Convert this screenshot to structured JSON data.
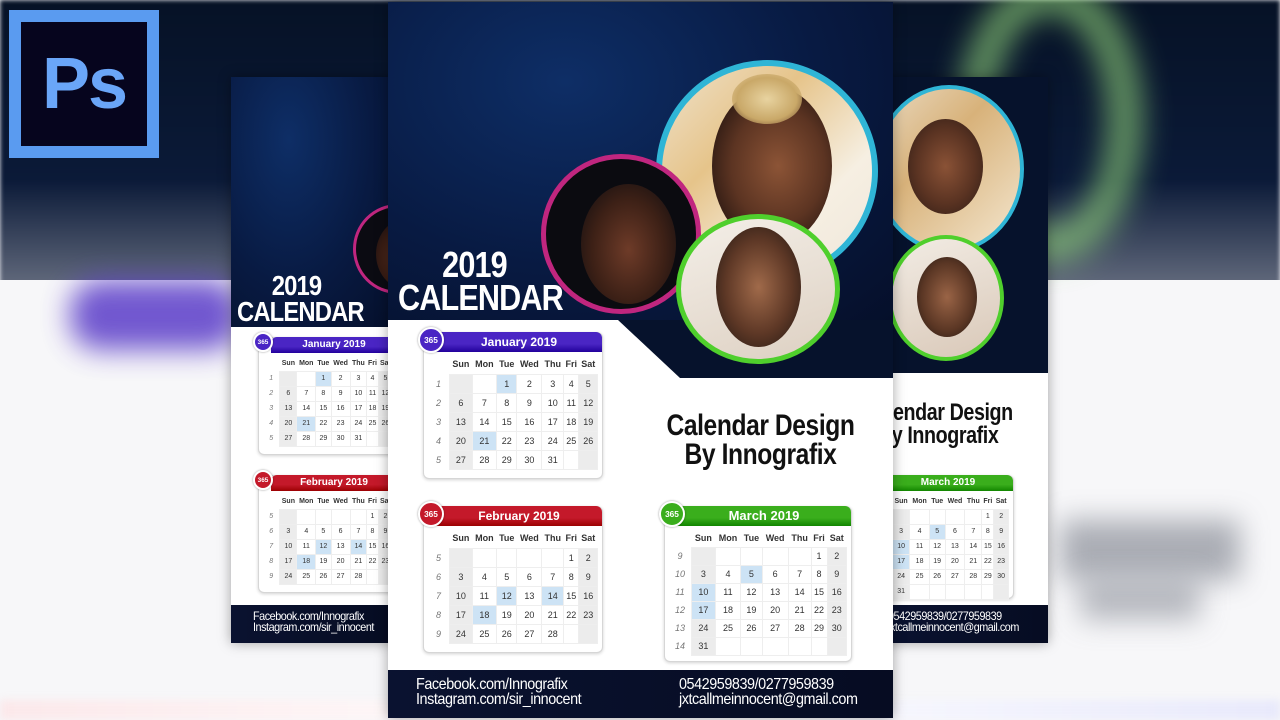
{
  "app": {
    "logo_text": "Ps",
    "logo_name": "Adobe Photoshop"
  },
  "poster": {
    "title_line1": "2019",
    "title_line2": "CALENDAR",
    "design_title_line1": "Calendar Design",
    "design_title_line2": "By Innografix",
    "footer": {
      "facebook": "Facebook.com/Innografix",
      "instagram": "Instagram.com/sir_innocent",
      "phone": "0542959839/0277959839",
      "email": "jxtcallmeinnocent@gmail.com"
    },
    "photo_ring_colors": {
      "top_right": "#2fb5d6",
      "left": "#c0267f",
      "bottom": "#4fcf2c"
    },
    "weekdays": [
      "Sun",
      "Mon",
      "Tue",
      "Wed",
      "Thu",
      "Fri",
      "Sat"
    ],
    "badge_text": "365",
    "calendars": [
      {
        "title": "January 2019",
        "color": "#4a25c4",
        "weeks": [
          {
            "num": "1",
            "days": [
              "",
              "",
              "1",
              "2",
              "3",
              "4",
              "5"
            ]
          },
          {
            "num": "2",
            "days": [
              "6",
              "7",
              "8",
              "9",
              "10",
              "11",
              "12"
            ]
          },
          {
            "num": "3",
            "days": [
              "13",
              "14",
              "15",
              "16",
              "17",
              "18",
              "19"
            ]
          },
          {
            "num": "4",
            "days": [
              "20",
              "21",
              "22",
              "23",
              "24",
              "25",
              "26"
            ]
          },
          {
            "num": "5",
            "days": [
              "27",
              "28",
              "29",
              "30",
              "31",
              "",
              ""
            ]
          }
        ],
        "highlighted": [
          "1",
          "21"
        ]
      },
      {
        "title": "February 2019",
        "color": "#c4192a",
        "weeks": [
          {
            "num": "5",
            "days": [
              "",
              "",
              "",
              "",
              "",
              "1",
              "2"
            ]
          },
          {
            "num": "6",
            "days": [
              "3",
              "4",
              "5",
              "6",
              "7",
              "8",
              "9"
            ]
          },
          {
            "num": "7",
            "days": [
              "10",
              "11",
              "12",
              "13",
              "14",
              "15",
              "16"
            ]
          },
          {
            "num": "8",
            "days": [
              "17",
              "18",
              "19",
              "20",
              "21",
              "22",
              "23"
            ]
          },
          {
            "num": "9",
            "days": [
              "24",
              "25",
              "26",
              "27",
              "28",
              "",
              ""
            ]
          }
        ],
        "highlighted": [
          "12",
          "14",
          "18"
        ]
      },
      {
        "title": "March 2019",
        "color": "#3aae1c",
        "weeks": [
          {
            "num": "9",
            "days": [
              "",
              "",
              "",
              "",
              "",
              "1",
              "2"
            ]
          },
          {
            "num": "10",
            "days": [
              "3",
              "4",
              "5",
              "6",
              "7",
              "8",
              "9"
            ]
          },
          {
            "num": "11",
            "days": [
              "10",
              "11",
              "12",
              "13",
              "14",
              "15",
              "16"
            ]
          },
          {
            "num": "12",
            "days": [
              "17",
              "18",
              "19",
              "20",
              "21",
              "22",
              "23"
            ]
          },
          {
            "num": "13",
            "days": [
              "24",
              "25",
              "26",
              "27",
              "28",
              "29",
              "30"
            ]
          },
          {
            "num": "14",
            "days": [
              "31",
              "",
              "",
              "",
              "",
              "",
              ""
            ]
          }
        ],
        "highlighted": [
          "5",
          "10",
          "17"
        ]
      }
    ]
  }
}
